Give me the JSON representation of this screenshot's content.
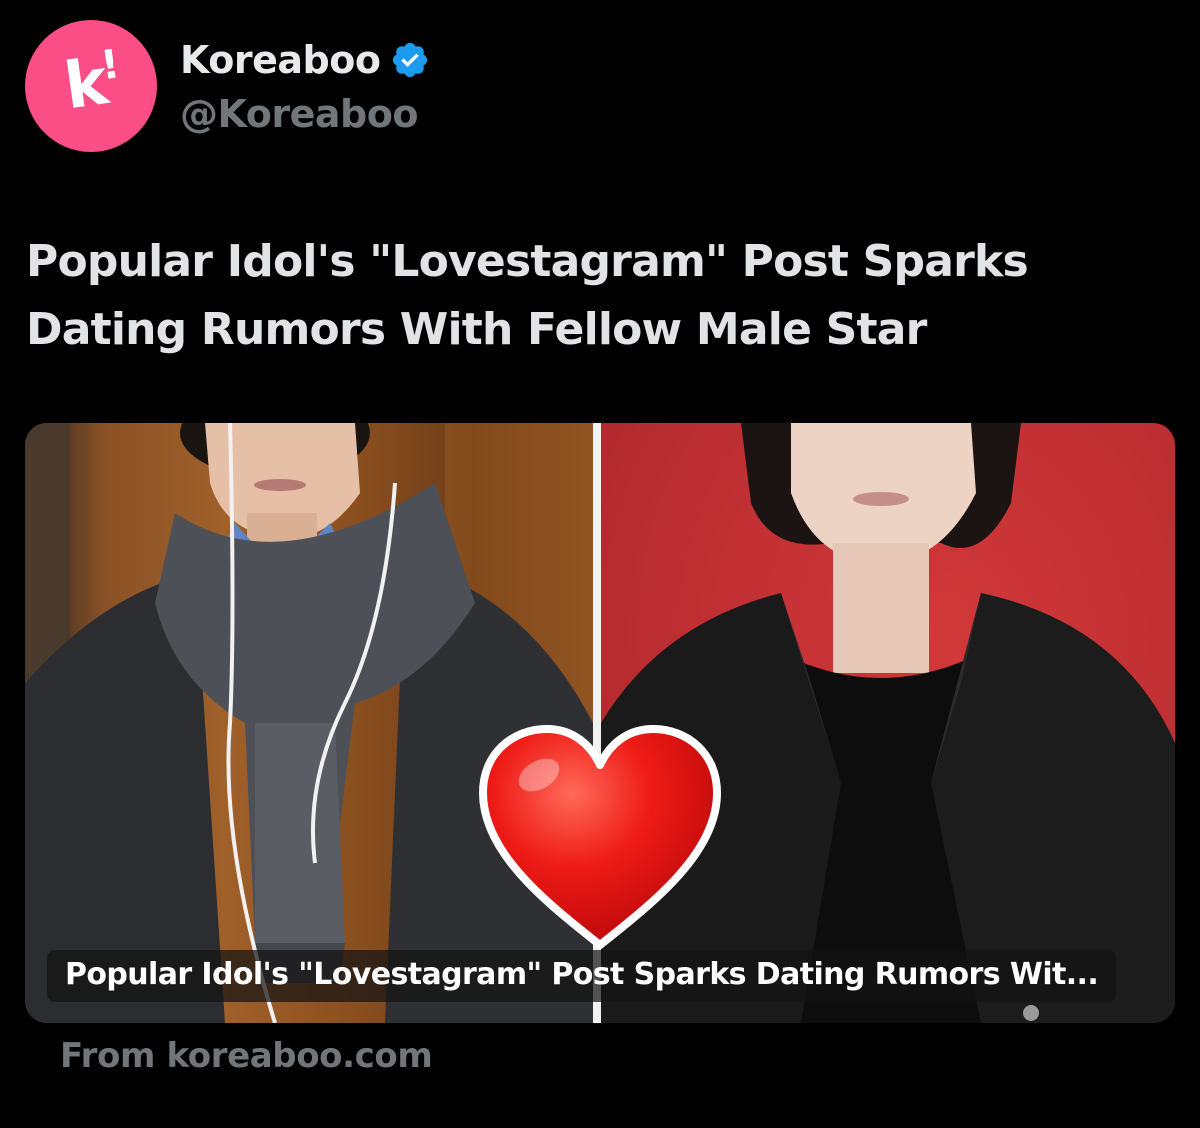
{
  "account": {
    "display_name": "Koreaboo",
    "handle": "@Koreaboo",
    "avatar_icon": "koreaboo-logo-icon",
    "avatar_color": "#fb4e86",
    "verified_icon": "verified-badge-icon",
    "verified_color": "#1d9bf0"
  },
  "tweet": {
    "text": "Popular Idol's \"Lovestagram\" Post Sparks\nDating Rumors With Fellow Male Star"
  },
  "card": {
    "caption": "Popular Idol's \"Lovestagram\" Post Sparks Dating Rumors Wit...",
    "overlay_icon": "red-heart-icon",
    "source": "From koreaboo.com"
  }
}
